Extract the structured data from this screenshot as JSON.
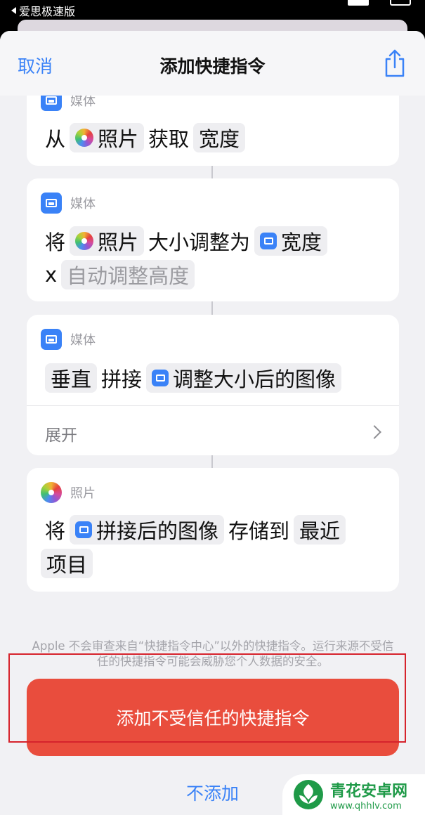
{
  "status_bar": {
    "back_app": "爱思极速版"
  },
  "nav": {
    "cancel": "取消",
    "title": "添加快捷指令",
    "share_icon": "share-icon"
  },
  "cards": [
    {
      "category": "媒体",
      "line1": {
        "w1": "从",
        "t1": "照片",
        "w2": "获取",
        "t2": "宽度"
      }
    },
    {
      "category": "媒体",
      "line1": {
        "w1": "将",
        "t1": "照片",
        "w2": "大小调整为",
        "t2": "宽度"
      },
      "line2": {
        "w1": "x",
        "t1": "自动调整高度"
      }
    },
    {
      "category": "媒体",
      "line1": {
        "t1": "垂直",
        "w1": "拼接",
        "t2": "调整大小后的图像"
      },
      "expand": "展开"
    },
    {
      "category": "照片",
      "line1": {
        "w1": "将",
        "t1": "拼接后的图像",
        "w2": "存储到",
        "t2": "最近"
      },
      "line2": {
        "t1": "项目"
      }
    }
  ],
  "disclaimer": "Apple 不会审查来自“快捷指令中心”以外的快捷指令。运行来源不受信任的快捷指令可能会威胁您个人数据的安全。",
  "add_button": "添加不受信任的快捷指令",
  "no_add_button": "不添加",
  "watermark": {
    "name": "青花安卓网",
    "url": "www.qhhlv.com"
  },
  "colors": {
    "accent": "#3a82f7",
    "danger": "#e94d3d",
    "highlight": "#d6232c"
  }
}
